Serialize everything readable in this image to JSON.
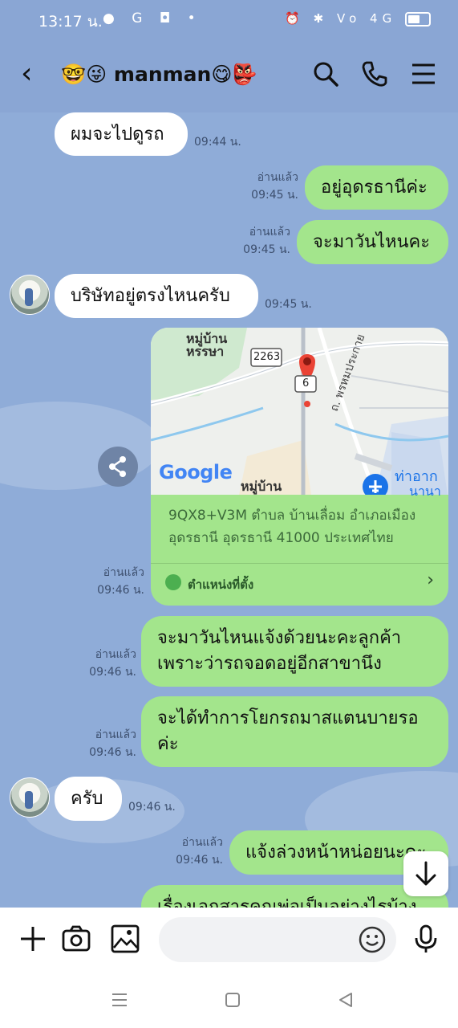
{
  "status_bar": {
    "time": "13:17 น.",
    "left_icons": "● G ◘ •",
    "right_icons": "⏰ ✱ Vo 4G"
  },
  "header": {
    "title": "🤓😜 manman😋👺"
  },
  "messages": [
    {
      "text": "ผมจะไปดูรถ",
      "time": "09:44 น."
    },
    {
      "text": "อยู่อุดรธานีค่ะ",
      "read": "อ่านแล้ว",
      "time": "09:45 น."
    },
    {
      "text": "จะมาวันไหนคะ",
      "read": "อ่านแล้ว",
      "time": "09:45 น."
    },
    {
      "text": "บริษัทอยู่ตรงไหนครับ",
      "time": "09:45 น."
    },
    {
      "read": "อ่านแล้ว",
      "time": "09:46 น."
    },
    {
      "line1": "จะมาวันไหนแจ้งด้วยนะคะลูกค้า",
      "line2": "เพราะว่ารถจอดอยู่อีกสาขานึง",
      "read": "อ่านแล้ว",
      "time": "09:46 น."
    },
    {
      "line1": "จะได้ทำการโยกรถมาสแตนบายรอ",
      "line2": "ค่ะ",
      "read": "อ่านแล้ว",
      "time": "09:46 น."
    },
    {
      "text": "ครับ",
      "time": "09:46 น."
    },
    {
      "text": "แจ้งล่วงหน้าหน่อยนะคะ",
      "read": "อ่านแล้ว",
      "time": "09:46 น."
    },
    {
      "text": "เรื่องเอกสารคุณพ่อเป็นอย่างไรบ้าง"
    }
  ],
  "location": {
    "map_labels": {
      "village1": "หมู่บ้าน",
      "village1b": "หรรษา",
      "road": "2263",
      "road2": "ถ. พรหมประกาย",
      "village2": "หมู่บ้าน",
      "airport": "ท่าอาก",
      "airport2": "นานา",
      "google": "Google",
      "route_suffix": "6"
    },
    "address_line1": "9QX8+V3M ตำบล บ้านเลื่อม อำเภอเมือง",
    "address_line2": "อุดรธานี อุดรธานี 41000 ประเทศไทย",
    "label": "ตำแหน่งที่ตั้ง"
  },
  "colors": {
    "chat_bg": "#8facd8",
    "out_bubble": "#a3e58c",
    "in_bubble": "#ffffff"
  }
}
